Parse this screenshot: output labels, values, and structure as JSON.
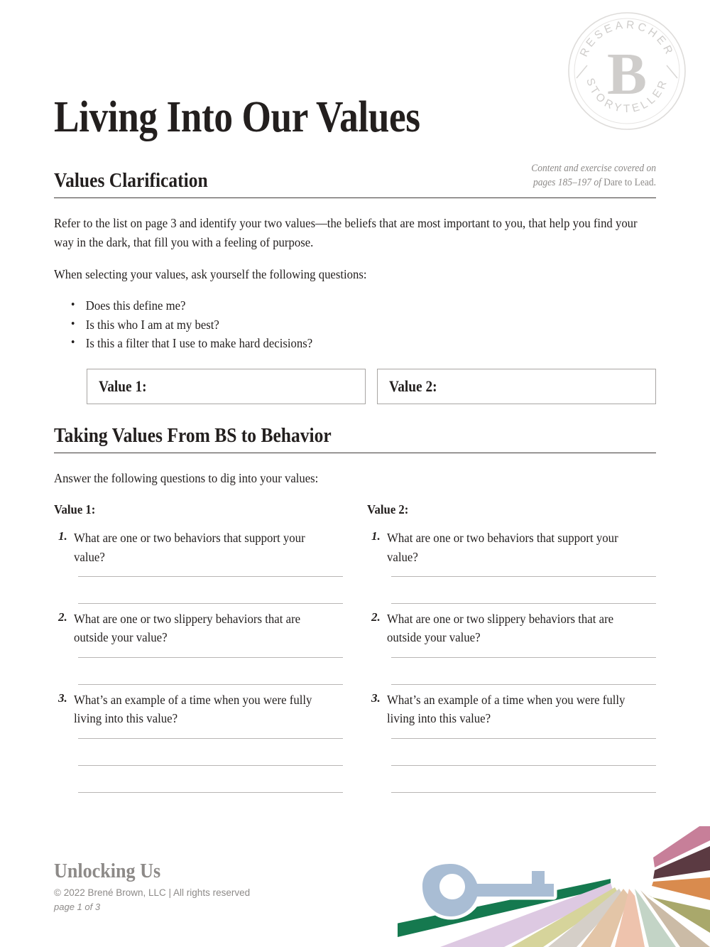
{
  "document": {
    "title": "Living Into Our Values"
  },
  "seal": {
    "top_text": "RESEARCHER",
    "bottom_text": "STORYTELLER",
    "monogram": "B",
    "color": "#cfcdcb"
  },
  "section1": {
    "title": "Values Clarification",
    "note_line1": "Content and exercise covered on",
    "note_line2_italic": "pages 185–197 of ",
    "note_line2_roman": "Dare to Lead.",
    "paragraph1": "Refer to the list on page 3 and identify your two values—the beliefs that are most important to you, that help you find your way in the dark, that fill you with a feeling of purpose.",
    "paragraph2": "When selecting your values, ask yourself the following questions:",
    "bullets": [
      "Does this define me?",
      "Is this who I am at my best?",
      "Is this a filter that I use to make hard decisions?"
    ],
    "value_box_1": "Value 1:",
    "value_box_2": "Value 2:"
  },
  "section2": {
    "title": "Taking Values From BS to Behavior",
    "intro": "Answer the following questions to dig into your values:",
    "columns": [
      {
        "heading": "Value 1:",
        "questions": [
          {
            "number": "1.",
            "text": "What are one or two behaviors that support your value?",
            "answer_lines": 2
          },
          {
            "number": "2.",
            "text": "What are one or two slippery behaviors that are outside your value?",
            "answer_lines": 2
          },
          {
            "number": "3.",
            "text": "What’s an example of a time when you were fully living into this value?",
            "answer_lines": 3
          }
        ]
      },
      {
        "heading": "Value 2:",
        "questions": [
          {
            "number": "1.",
            "text": "What are one or two behaviors that support your value?",
            "answer_lines": 2
          },
          {
            "number": "2.",
            "text": "What are one or two slippery behaviors that are outside your value?",
            "answer_lines": 2
          },
          {
            "number": "3.",
            "text": "What’s an example of a time when you were fully living into this value?",
            "answer_lines": 3
          }
        ]
      }
    ]
  },
  "footer": {
    "brand": "Unlocking Us",
    "copyright": "© 2022 Brené Brown, LLC | All rights reserved",
    "page": "page 1 of 3"
  },
  "artwork": {
    "key_color": "#a9bdd4",
    "ray_colors": [
      "#15794f",
      "#ddc9e2",
      "#d6d49b",
      "#d5cfc8",
      "#e3c5a7",
      "#eec3ad",
      "#c3d4c6",
      "#cbbba6",
      "#a9a86b",
      "#d98b4e",
      "#5b3a42",
      "#c77f99"
    ]
  }
}
